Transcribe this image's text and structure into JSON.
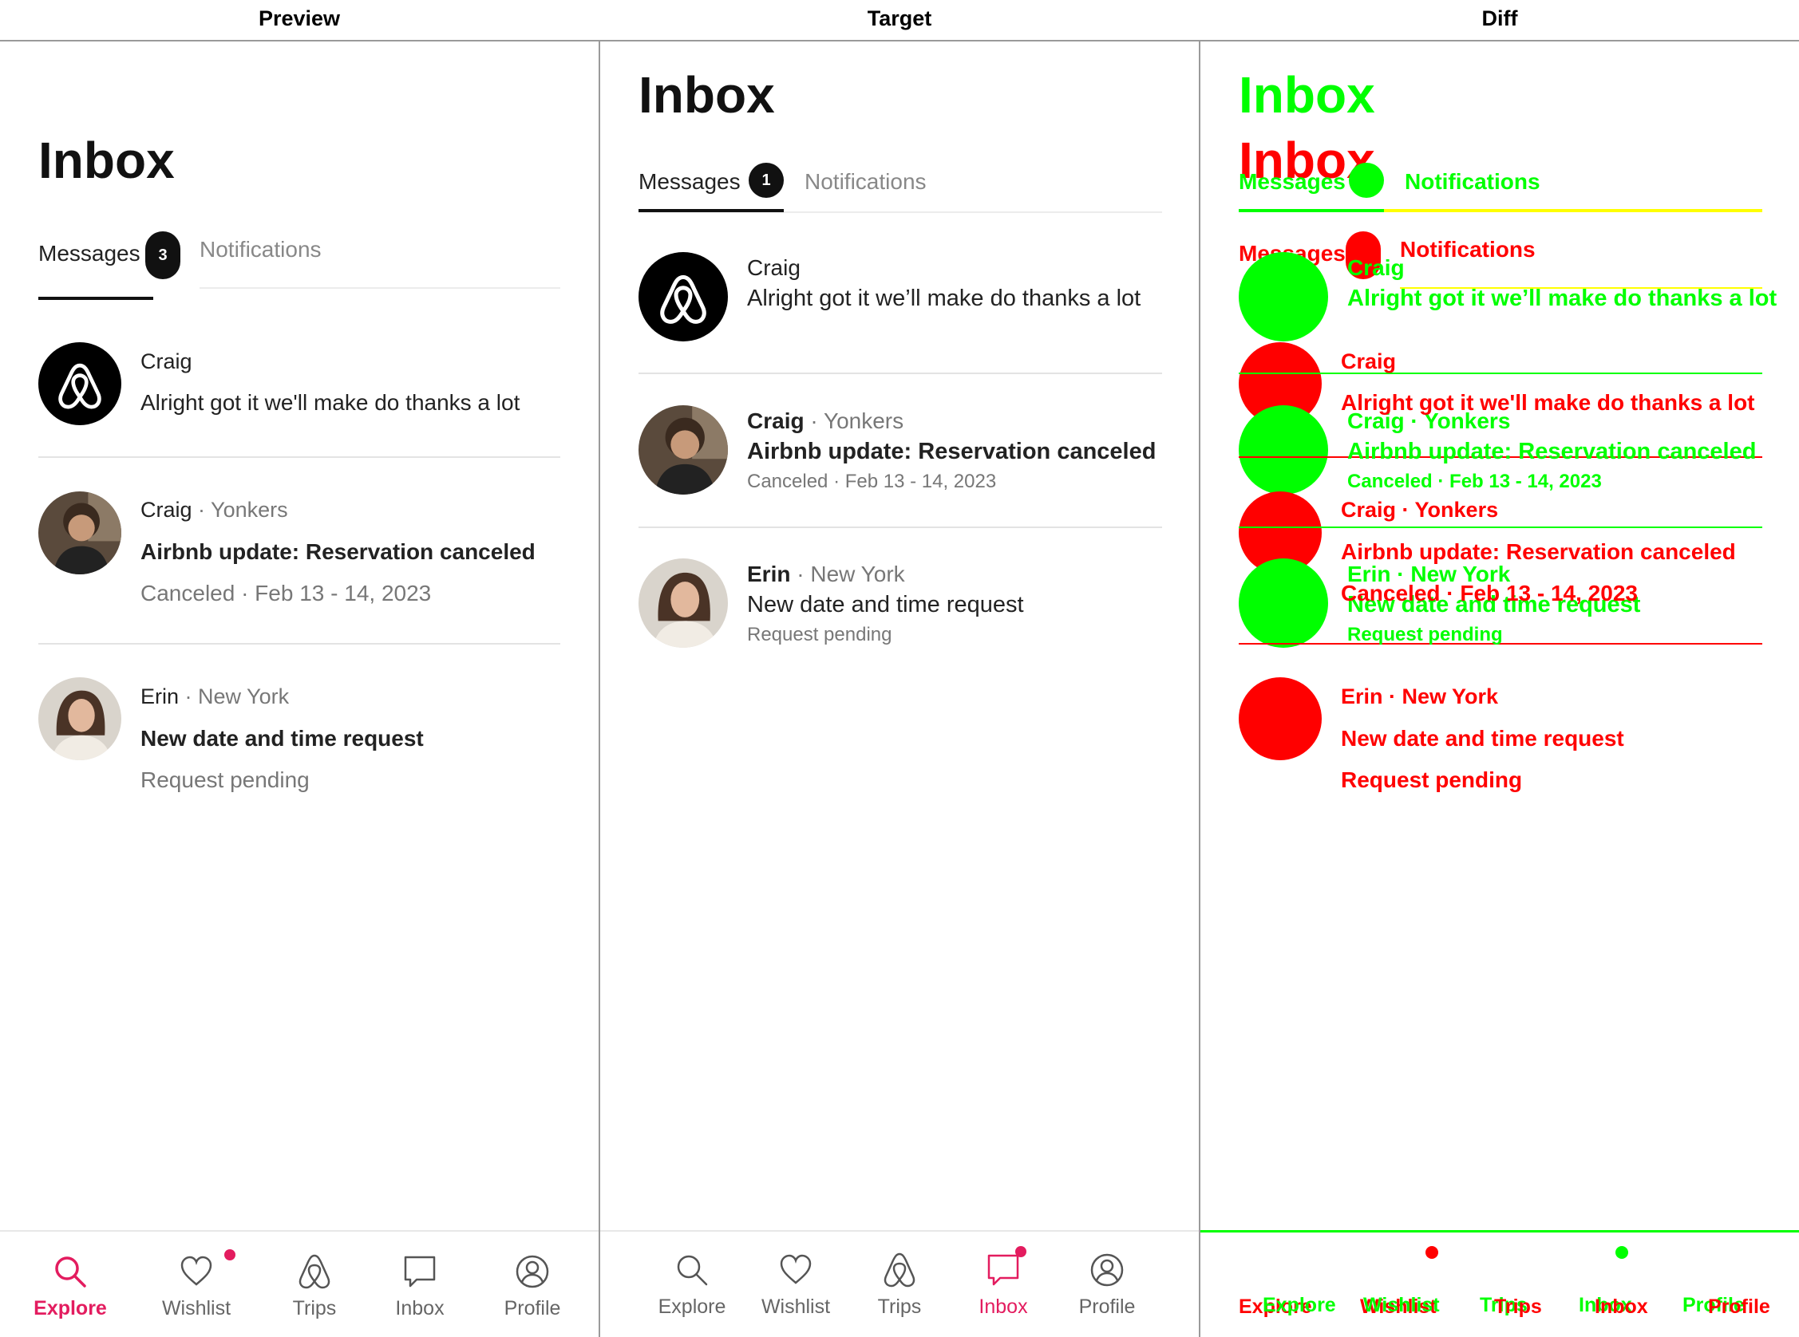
{
  "headers": {
    "preview": "Preview",
    "target": "Target",
    "diff": "Diff"
  },
  "colors": {
    "accent": "#e31c5f",
    "text": "#222222",
    "muted": "#777777",
    "diff_added": "#00ff00",
    "diff_removed": "#ff0000",
    "diff_overlap": "#ffff00"
  },
  "preview": {
    "title": "Inbox",
    "tabs": {
      "messages": "Messages",
      "messages_badge": "3",
      "notifications": "Notifications"
    },
    "threads": [
      {
        "name": "Craig",
        "location": "",
        "message": "Alright got it we'll make do thanks a lot",
        "subline": "",
        "avatar": "airbnb-logo"
      },
      {
        "name": "Craig",
        "location": "Yonkers",
        "message": "Airbnb update: Reservation canceled",
        "subline": "Canceled · Feb 13 - 14, 2023",
        "avatar": "photo-craig"
      },
      {
        "name": "Erin",
        "location": "New York",
        "message": "New date and time request",
        "subline": "Request pending",
        "avatar": "photo-erin"
      }
    ],
    "nav": [
      {
        "label": "Explore",
        "icon": "search-icon",
        "active": true,
        "dot": false
      },
      {
        "label": "Wishlist",
        "icon": "heart-icon",
        "active": false,
        "dot": true
      },
      {
        "label": "Trips",
        "icon": "airbnb-icon",
        "active": false,
        "dot": false
      },
      {
        "label": "Inbox",
        "icon": "message-icon",
        "active": false,
        "dot": false
      },
      {
        "label": "Profile",
        "icon": "profile-icon",
        "active": false,
        "dot": false
      }
    ]
  },
  "target": {
    "title": "Inbox",
    "tabs": {
      "messages": "Messages",
      "messages_badge": "1",
      "notifications": "Notifications"
    },
    "threads": [
      {
        "name": "Craig",
        "location": "",
        "message": "Alright got it we’ll make do thanks a lot",
        "subline": "",
        "avatar": "airbnb-logo"
      },
      {
        "name": "Craig",
        "location": "Yonkers",
        "message": "Airbnb update: Reservation canceled",
        "subline": "Canceled · Feb 13 - 14, 2023",
        "avatar": "photo-craig"
      },
      {
        "name": "Erin",
        "location": "New York",
        "message": "New date and time request",
        "subline": "Request pending",
        "avatar": "photo-erin"
      }
    ],
    "nav": [
      {
        "label": "Explore",
        "icon": "search-icon",
        "active": false,
        "dot": false
      },
      {
        "label": "Wishlist",
        "icon": "heart-icon",
        "active": false,
        "dot": false
      },
      {
        "label": "Trips",
        "icon": "airbnb-icon",
        "active": false,
        "dot": false
      },
      {
        "label": "Inbox",
        "icon": "message-icon",
        "active": true,
        "dot": true
      },
      {
        "label": "Profile",
        "icon": "profile-icon",
        "active": false,
        "dot": false
      }
    ]
  }
}
